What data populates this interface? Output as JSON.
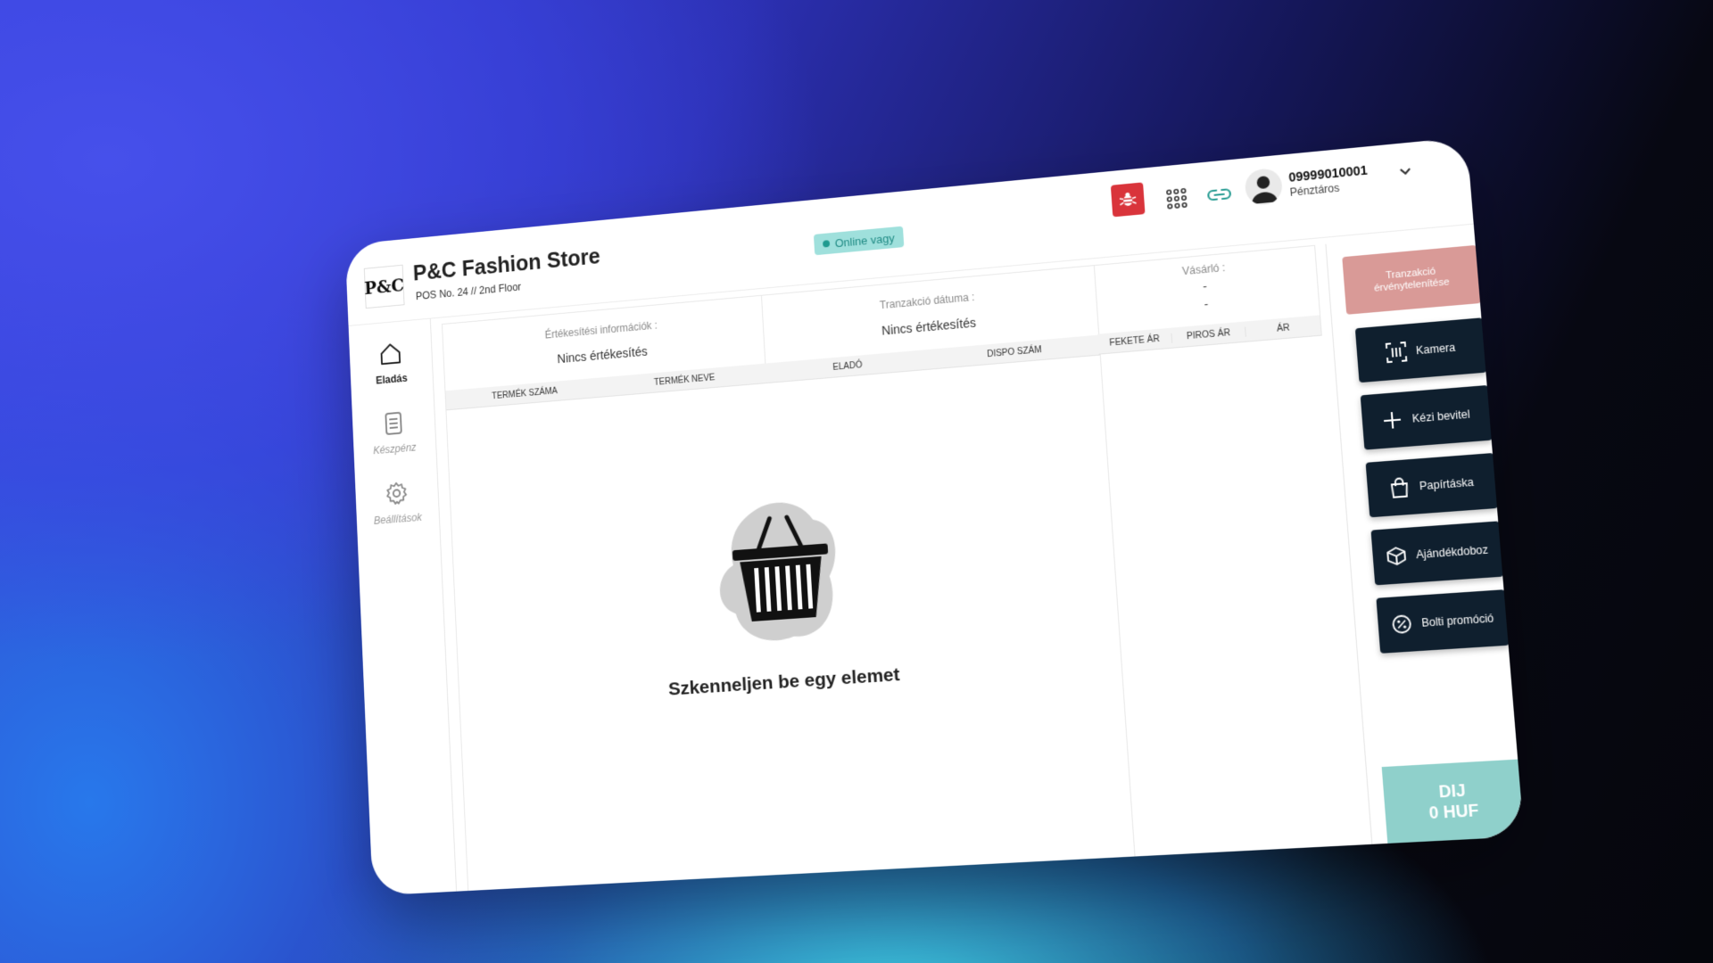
{
  "header": {
    "logo_text": "P&C",
    "store_name": "P&C Fashion Store",
    "store_sub": "POS No. 24 // 2nd Floor",
    "status": "Online vagy",
    "user_id": "09999010001",
    "user_role": "Pénztáros"
  },
  "sidebar": {
    "items": [
      {
        "label": "Eladás",
        "icon": "home-icon"
      },
      {
        "label": "Készpénz",
        "icon": "document-icon"
      },
      {
        "label": "Beállítások",
        "icon": "gear-icon"
      }
    ]
  },
  "info": {
    "sales_title": "Értékesítési információk :",
    "sales_value": "Nincs értékesítés",
    "date_title": "Tranzakció dátuma :",
    "date_value": "Nincs értékesítés",
    "customer_title": "Vásárló :",
    "customer_line1": "-",
    "customer_line2": "-"
  },
  "table": {
    "columns": [
      "TERMÉK SZÁMA",
      "TERMÉK NEVE",
      "ELADÓ",
      "DISPO SZÁM"
    ],
    "price_columns": [
      "FEKETE ÁR",
      "PIROS ÁR",
      "ÁR"
    ]
  },
  "empty": {
    "message": "Szkenneljen be egy elemet"
  },
  "actions": {
    "void": "Tranzakció érvénytelenítése",
    "camera": "Kamera",
    "manual": "Kézi bevitel",
    "paper_bag": "Papírtáska",
    "gift_box": "Ajándékdoboz",
    "promo": "Bolti promóció"
  },
  "fee": {
    "label": "DIJ",
    "amount": "0 HUF"
  },
  "colors": {
    "void_button": "#d99a97",
    "action_button": "#0f1f2e",
    "fee_panel": "#8fd0cb",
    "online_badge": "#9fe0dc",
    "bug_button": "#d9343b"
  }
}
